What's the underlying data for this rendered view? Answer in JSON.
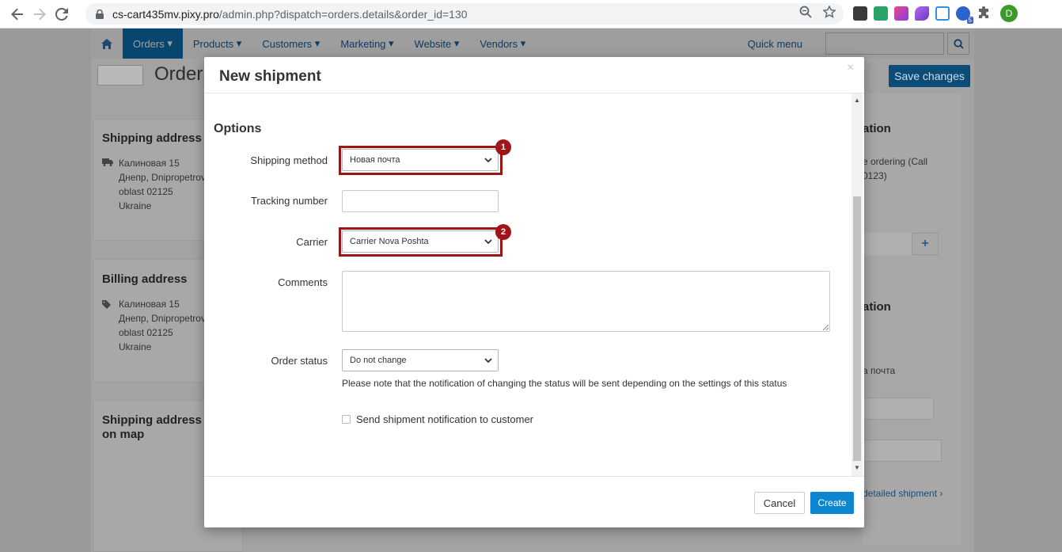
{
  "browser": {
    "url_host": "cs-cart435mv.pixy.pro",
    "url_path": "/admin.php?dispatch=orders.details&order_id=130",
    "avatar_letter": "D",
    "ext_badge": "5"
  },
  "admin": {
    "nav": [
      "Orders",
      "Products",
      "Customers",
      "Marketing",
      "Website",
      "Vendors"
    ],
    "quick_menu": "Quick menu",
    "page_title": "Order",
    "save_changes": "Save changes",
    "shipping_address": {
      "title": "Shipping address",
      "lines": [
        "Калиновая 15",
        "Днепр, Dnipropetrov",
        "oblast 02125",
        "Ukraine"
      ]
    },
    "billing_address": {
      "title": "Billing address",
      "lines": [
        "Калиновая 15",
        "Днепр, Dnipropetrov",
        "oblast 02125",
        "Ukraine"
      ]
    },
    "map_card": {
      "title_1": "Shipping address",
      "title_2": "on map"
    },
    "right": {
      "heading_1": "ation",
      "text_1": "e ordering (Call",
      "text_2": "0123)",
      "heading_2": "ation",
      "text_3": "а почта",
      "link": "detailed shipment"
    }
  },
  "modal": {
    "title": "New shipment",
    "close": "×",
    "section": "Options",
    "shipping_method": {
      "label": "Shipping method",
      "value": "Новая почта",
      "badge": "1"
    },
    "tracking_number": {
      "label": "Tracking number",
      "value": ""
    },
    "carrier": {
      "label": "Carrier",
      "value": "Carrier Nova Poshta",
      "badge": "2"
    },
    "comments": {
      "label": "Comments"
    },
    "order_status": {
      "label": "Order status",
      "value": "Do not change",
      "note": "Please note that the notification of changing the status will be sent depending on the settings of this status"
    },
    "notify": "Send shipment notification to customer",
    "cancel": "Cancel",
    "create": "Create"
  },
  "colors": {
    "highlight": "#9e1518",
    "create": "#0c86d1",
    "nav_active": "#0c72b3"
  }
}
